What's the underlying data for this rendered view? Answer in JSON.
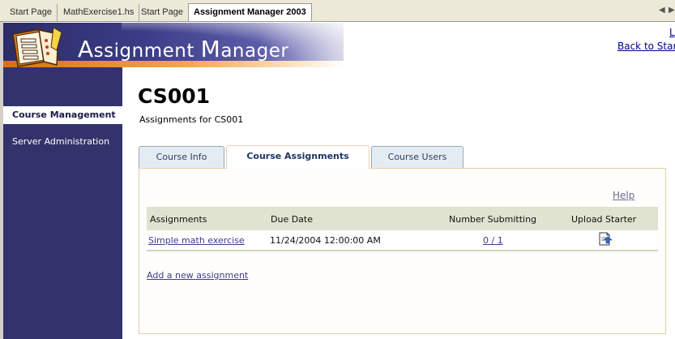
{
  "doc_tabs": [
    {
      "label": "Start Page",
      "active": false
    },
    {
      "label": "MathExercise1.hs",
      "active": false
    },
    {
      "label": "Start Page",
      "active": false
    },
    {
      "label": "Assignment Manager 2003",
      "active": true
    }
  ],
  "banner": {
    "title_first_cap": "A",
    "title_part1": "ssignment ",
    "title_second_cap": "M",
    "title_part2": "anager"
  },
  "top_links": {
    "first": "L",
    "back": "Back to Star"
  },
  "leftnav": {
    "items": [
      {
        "label": "Course Management",
        "selected": true
      },
      {
        "label": "Server Administration",
        "selected": false
      }
    ]
  },
  "page": {
    "title": "CS001",
    "subtitle": "Assignments for CS001"
  },
  "course_tabs": [
    {
      "label": "Course Info",
      "active": false
    },
    {
      "label": "Course Assignments",
      "active": true
    },
    {
      "label": "Course Users",
      "active": false
    }
  ],
  "help_label": "Help",
  "table": {
    "columns": [
      "Assignments",
      "Due Date",
      "Number Submitting",
      "Upload Starter"
    ],
    "rows": [
      {
        "assignment": "Simple math exercise",
        "due_date": "11/24/2004 12:00:00 AM",
        "submitting": "0 / 1",
        "upload_icon": "upload-document-icon"
      }
    ]
  },
  "add_link": "Add a new assignment",
  "colors": {
    "nav_bg": "#33336b",
    "banner_orange": "#d96f12",
    "grid_header": "#dfe3cf",
    "link": "#3d3d8a"
  }
}
